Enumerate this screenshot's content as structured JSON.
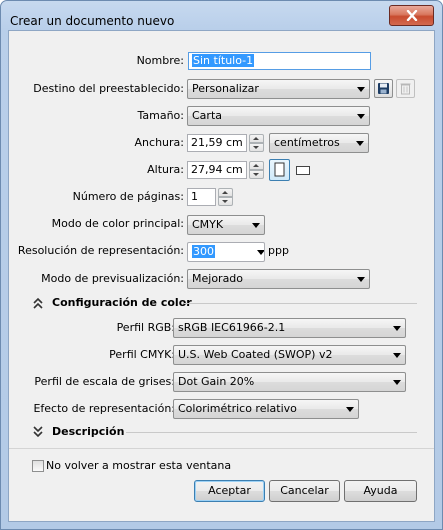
{
  "window": {
    "title": "Crear un documento nuevo"
  },
  "form": {
    "nombre": {
      "label": "Nombre:",
      "value": "Sin título-1"
    },
    "destino": {
      "label": "Destino del preestablecido:",
      "value": "Personalizar"
    },
    "tamano": {
      "label": "Tamaño:",
      "value": "Carta"
    },
    "anchura": {
      "label": "Anchura:",
      "value": "21,59 cm",
      "unit": "centímetros"
    },
    "altura": {
      "label": "Altura:",
      "value": "27,94 cm"
    },
    "paginas": {
      "label": "Número de páginas:",
      "value": "1"
    },
    "modo_color": {
      "label": "Modo de color principal:",
      "value": "CMYK"
    },
    "resolucion": {
      "label": "Resolución de representación:",
      "value": "300",
      "unit": "ppp"
    },
    "previsualizacion": {
      "label": "Modo de previsualización:",
      "value": "Mejorado"
    }
  },
  "color_section": {
    "title": "Configuración de color",
    "perfil_rgb": {
      "label": "Perfil RGB:",
      "value": "sRGB IEC61966-2.1"
    },
    "perfil_cmyk": {
      "label": "Perfil CMYK:",
      "value": "U.S. Web Coated (SWOP) v2"
    },
    "perfil_grises": {
      "label": "Perfil de escala de grises:",
      "value": "Dot Gain 20%"
    },
    "efecto": {
      "label": "Efecto de representación:",
      "value": "Colorimétrico relativo"
    }
  },
  "description_section": {
    "title": "Descripción"
  },
  "footer": {
    "checkbox_label": "No volver a mostrar esta ventana",
    "accept": "Aceptar",
    "cancel": "Cancelar",
    "help": "Ayuda"
  }
}
